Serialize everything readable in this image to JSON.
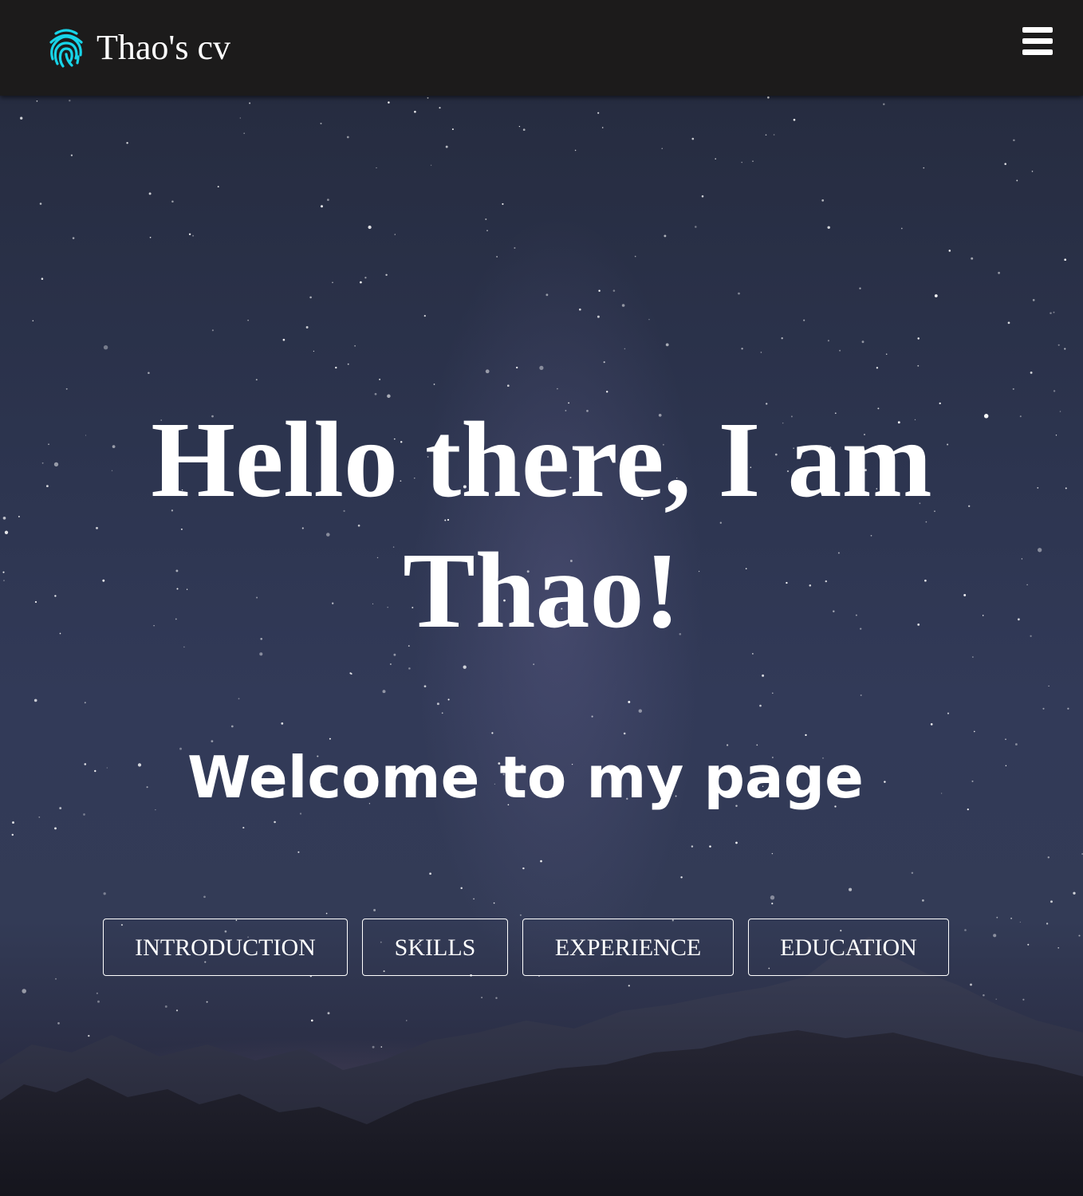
{
  "navbar": {
    "brand_icon": "fingerprint-icon",
    "brand_icon_color": "#17d4e8",
    "brand_name": "Thao's cv",
    "menu_icon": "hamburger-menu-icon"
  },
  "hero": {
    "heading": "Hello there, I am Thao!",
    "subheading": "Welcome to my page",
    "background": "starry night sky over mountains"
  },
  "sections": {
    "introduction": "INTRODUCTION",
    "skills": "SKILLS",
    "experience": "EXPERIENCE",
    "education": "EDUCATION"
  },
  "colors": {
    "navbar_bg": "#1c1b1b",
    "accent": "#17d4e8",
    "text": "#ffffff"
  }
}
